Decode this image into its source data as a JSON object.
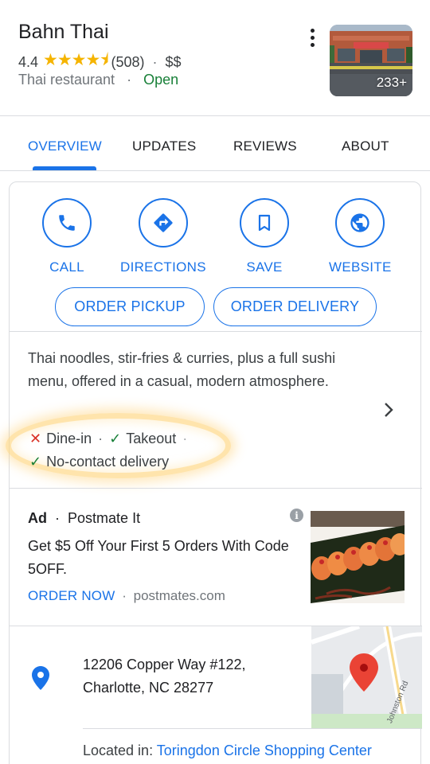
{
  "place": {
    "name": "Bahn Thai",
    "rating": "4.4",
    "stars": "★★★★⯨",
    "review_count": "(508)",
    "price": "$$",
    "category": "Thai restaurant",
    "status": "Open",
    "photo_count": "233+"
  },
  "tabs": [
    {
      "label": "OVERVIEW",
      "active": true
    },
    {
      "label": "UPDATES"
    },
    {
      "label": "REVIEWS"
    },
    {
      "label": "ABOUT"
    }
  ],
  "actions": [
    {
      "label": "CALL",
      "icon": "phone-icon"
    },
    {
      "label": "DIRECTIONS",
      "icon": "directions-icon"
    },
    {
      "label": "SAVE",
      "icon": "bookmark-icon"
    },
    {
      "label": "WEBSITE",
      "icon": "globe-icon"
    }
  ],
  "order_buttons": {
    "pickup": "ORDER PICKUP",
    "delivery": "ORDER DELIVERY"
  },
  "description": "Thai noodles, stir-fries & curries, plus a full sushi menu, offered in a casual, modern atmosphere.",
  "services": {
    "dine_in": "Dine-in",
    "takeout": "Takeout",
    "no_contact": "No-contact delivery"
  },
  "ad": {
    "badge": "Ad",
    "advertiser": "Postmate It",
    "headline": "Get $5 Off Your First 5 Orders With Code 5OFF.",
    "cta": "ORDER NOW",
    "domain": "postmates.com"
  },
  "address": {
    "line1": "12206 Copper Way #122,",
    "line2": "Charlotte, NC 28277",
    "located_prefix": "Located in:",
    "located_place": "Toringdon Circle Shopping Center",
    "map_road_label": "Johnston Rd"
  },
  "colors": {
    "accent": "#1a73e8",
    "open": "#188038",
    "star": "#f5b400",
    "no": "#d93025",
    "highlight": "#ffd580"
  }
}
